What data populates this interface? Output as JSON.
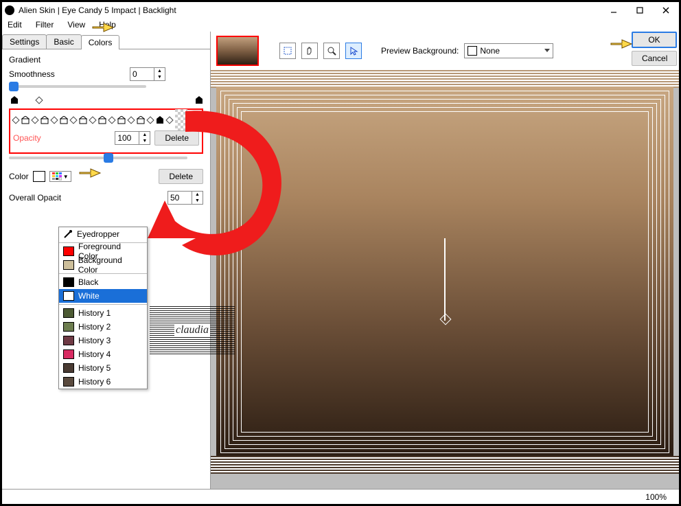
{
  "titlebar": {
    "title": "Alien Skin | Eye Candy 5 Impact | Backlight"
  },
  "menu": {
    "edit": "Edit",
    "filter": "Filter",
    "view": "View",
    "help": "Help"
  },
  "tabs": {
    "settings": "Settings",
    "basic": "Basic",
    "colors": "Colors"
  },
  "panel": {
    "gradient_label": "Gradient",
    "smoothness_label": "Smoothness",
    "smoothness_value": "0",
    "opacity_label": "Opacity",
    "opacity_value": "100",
    "delete1": "Delete",
    "color_label": "Color",
    "delete2": "Delete",
    "overall_opacity_label": "Overall Opacit",
    "overall_opacity_value": "50"
  },
  "color_popup": {
    "eyedropper": "Eyedropper",
    "fg": "Foreground Color",
    "bg": "Background Color",
    "black": "Black",
    "white": "White",
    "h1": "History 1",
    "h2": "History 2",
    "h3": "History 3",
    "h4": "History 4",
    "h5": "History 5",
    "h6": "History 6",
    "colors": {
      "fg": "#ff0000",
      "bg": "#cdbf9b",
      "black": "#000000",
      "white": "#ffffff",
      "h1": "#4c5a33",
      "h2": "#6d7d4f",
      "h3": "#6f3a45",
      "h4": "#d82a62",
      "h5": "#4a3b33",
      "h6": "#5a4a3e"
    }
  },
  "right": {
    "preview_bg_label": "Preview Background:",
    "preview_bg_value": "None"
  },
  "buttons": {
    "ok": "OK",
    "cancel": "Cancel"
  },
  "status": {
    "zoom": "100%"
  },
  "watermark": "claudia"
}
